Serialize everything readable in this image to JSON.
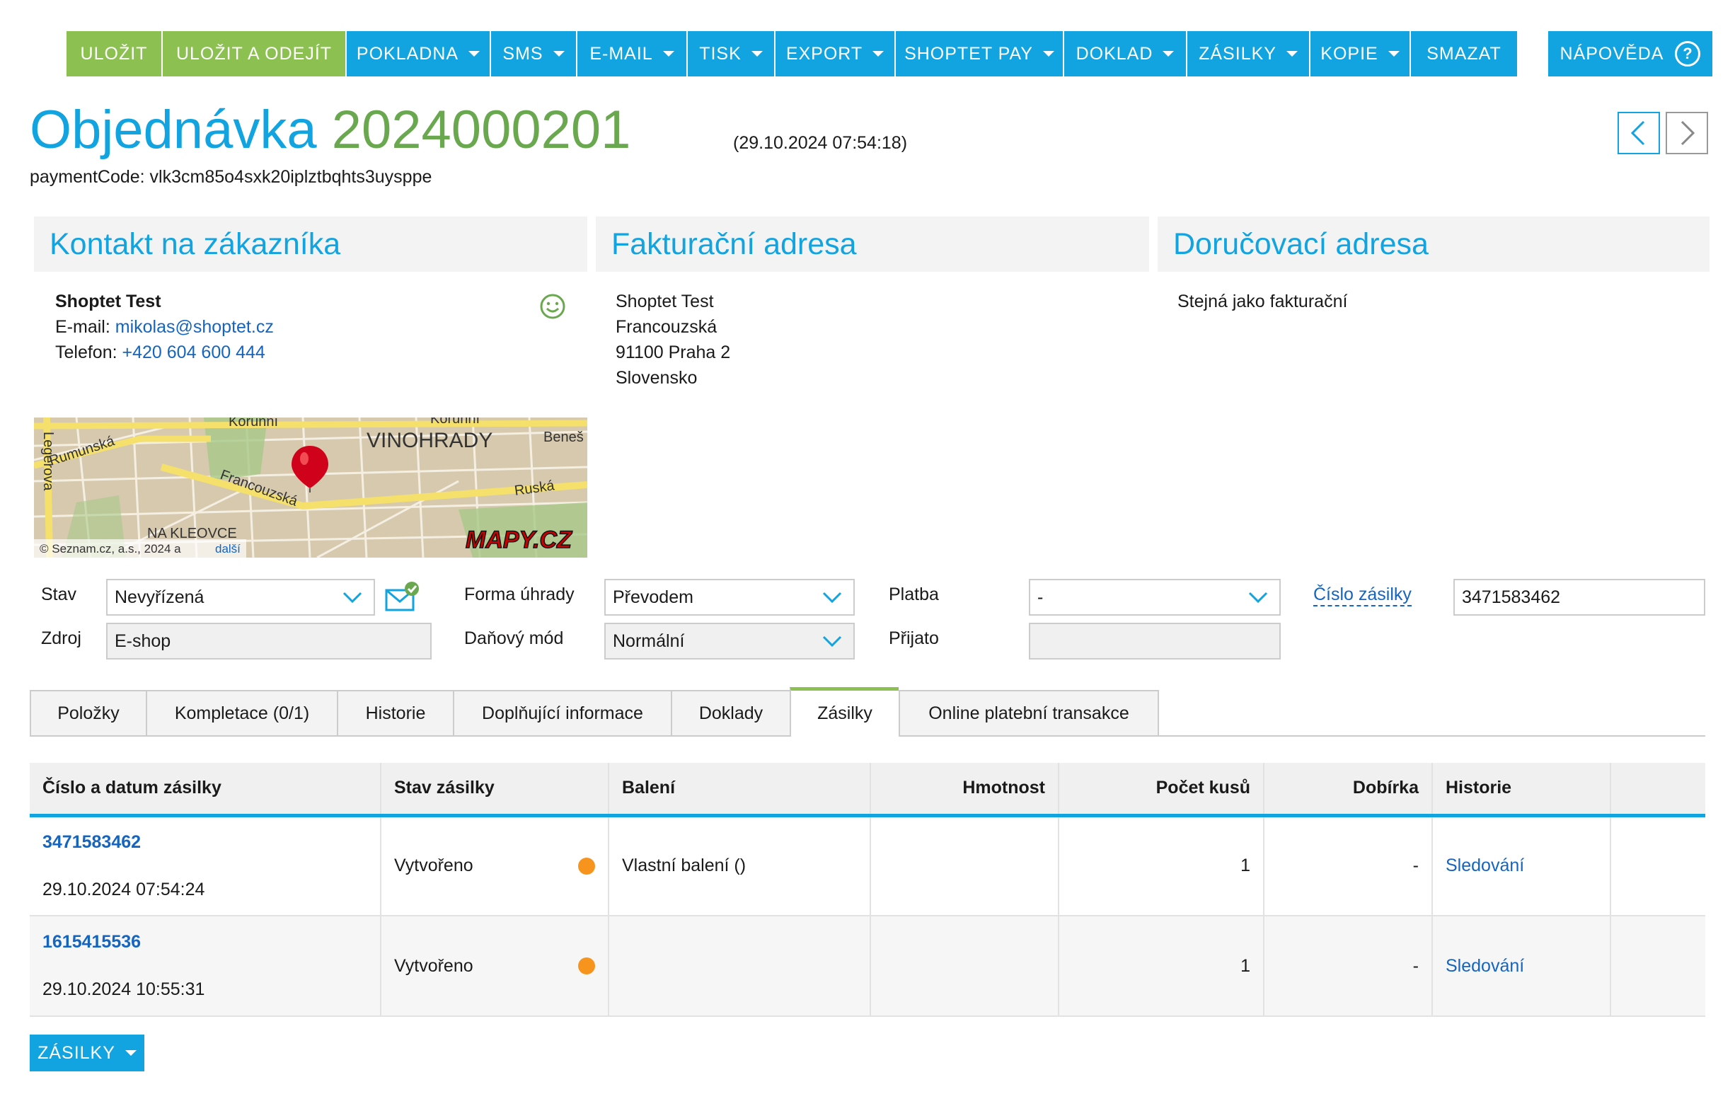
{
  "toolbar": {
    "buttons": [
      {
        "label": "ULOŽIT",
        "dropdown": false
      },
      {
        "label": "ULOŽIT A ODEJÍT",
        "dropdown": false
      },
      {
        "label": "POKLADNA",
        "dropdown": true
      },
      {
        "label": "SMS",
        "dropdown": true
      },
      {
        "label": "E-MAIL",
        "dropdown": true
      },
      {
        "label": "TISK",
        "dropdown": true
      },
      {
        "label": "EXPORT",
        "dropdown": true
      },
      {
        "label": "SHOPTET PAY",
        "dropdown": true
      },
      {
        "label": "DOKLAD",
        "dropdown": true
      },
      {
        "label": "ZÁSILKY",
        "dropdown": true
      },
      {
        "label": "KOPIE",
        "dropdown": true
      },
      {
        "label": "SMAZAT",
        "dropdown": false
      }
    ],
    "help_label": "NÁPOVĚDA",
    "help_icon": "?"
  },
  "header": {
    "title_word": "Objednávka",
    "order_number": "2024000201",
    "created": "(29.10.2024 07:54:18)",
    "payment_code": "paymentCode: vlk3cm85o4sxk20iplztbqhts3uysppe"
  },
  "contact": {
    "heading": "Kontakt na zákazníka",
    "name": "Shoptet Test",
    "email_label": "E-mail:",
    "email": "mikolas@shoptet.cz",
    "phone_label": "Telefon:",
    "phone": "+420 604 600 444"
  },
  "billing": {
    "heading": "Fakturační adresa",
    "lines": [
      "Shoptet Test",
      "Francouzská",
      "91100 Praha 2",
      "Slovensko"
    ]
  },
  "delivery": {
    "heading": "Doručovací adresa",
    "text": "Stejná jako fakturační"
  },
  "map": {
    "labels": {
      "korunni1": "Korunní",
      "korunni2": "Korunní",
      "vinohrady": "VINOHRADY",
      "benes": "Beneš",
      "legerova": "Legerova",
      "rumunska": "Rumunská",
      "francouzska": "Francouzská",
      "ruska": "Ruská",
      "kleovce": "NA KLEOVCE",
      "copyright": "© Seznam.cz, a.s., 2024 a",
      "copyright_link": "další",
      "logo": "MAPY.CZ"
    }
  },
  "form": {
    "stav_label": "Stav",
    "stav_value": "Nevyřízená",
    "zdroj_label": "Zdroj",
    "zdroj_value": "E-shop",
    "forma_label": "Forma úhrady",
    "forma_value": "Převodem",
    "danovy_label": "Daňový mód",
    "danovy_value": "Normální",
    "platba_label": "Platba",
    "platba_value": "-",
    "prijato_label": "Přijato",
    "prijato_value": "",
    "cislo_label": "Číslo zásilky",
    "cislo_value": "3471583462"
  },
  "tabs": [
    {
      "label": "Položky",
      "active": false
    },
    {
      "label": "Kompletace (0/1)",
      "active": false
    },
    {
      "label": "Historie",
      "active": false
    },
    {
      "label": "Doplňující informace",
      "active": false
    },
    {
      "label": "Doklady",
      "active": false
    },
    {
      "label": "Zásilky",
      "active": true
    },
    {
      "label": "Online platební transakce",
      "active": false
    }
  ],
  "table": {
    "columns": [
      "Číslo a datum zásilky",
      "Stav zásilky",
      "Balení",
      "Hmotnost",
      "Počet kusů",
      "Dobírka",
      "Historie"
    ],
    "rows": [
      {
        "number": "3471583462",
        "date": "29.10.2024 07:54:24",
        "status": "Vytvořeno",
        "status_color": "#f7941d",
        "packaging": "Vlastní balení ()",
        "weight": "",
        "pieces": "1",
        "cod": "-",
        "history": "Sledování"
      },
      {
        "number": "1615415536",
        "date": "29.10.2024 10:55:31",
        "status": "Vytvořeno",
        "status_color": "#f7941d",
        "packaging": "",
        "weight": "",
        "pieces": "1",
        "cod": "-",
        "history": "Sledování"
      }
    ]
  },
  "bottom_button": "ZÁSILKY",
  "colors": {
    "accent_blue": "#11a4e0",
    "accent_green": "#8cc152",
    "title_green": "#6aa84f",
    "status_orange": "#f7941d",
    "link": "#1565c0"
  }
}
